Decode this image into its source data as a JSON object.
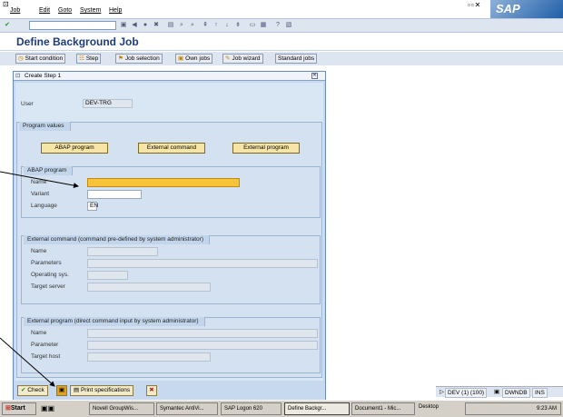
{
  "menubar": {
    "items": [
      "Job",
      "Edit",
      "Goto",
      "System",
      "Help"
    ],
    "logo": "SAP"
  },
  "page_title": "Define Background Job",
  "appbar": {
    "buttons": [
      "Start condition",
      "Step",
      "Job selection",
      "Own jobs",
      "Job wizard",
      "Standard jobs"
    ]
  },
  "dialog": {
    "title": "Create Step 1",
    "user_label": "User",
    "user_value": "DEV-TRG",
    "program_values_title": "Program values",
    "buttons": [
      "ABAP program",
      "External command",
      "External program"
    ],
    "abap_group": {
      "title": "ABAP program",
      "fields": [
        {
          "label": "Name",
          "value": ""
        },
        {
          "label": "Variant",
          "value": ""
        },
        {
          "label": "Language",
          "value": "EN"
        }
      ]
    },
    "ext_cmd_group": {
      "title": "External command (command pre-defined by system administrator)",
      "fields": [
        "Name",
        "Parameters",
        "Operating sys.",
        "Target server"
      ]
    },
    "ext_prog_group": {
      "title": "External program (direct command input by system administrator)",
      "fields": [
        "Name",
        "Parameter",
        "Target host"
      ]
    },
    "footer": {
      "check": "Check",
      "print": "Print specifications"
    }
  },
  "statusbar": {
    "system": "DEV (1) (100)",
    "server": "DWNDB",
    "mode": "INS"
  },
  "taskbar": {
    "start": "Start",
    "tasks": [
      "Novell GroupWis...",
      "Symantec AntiVi...",
      "SAP Logon 620",
      "Define Backgr...",
      "Document1 - Mic..."
    ],
    "desktop": "Desktop",
    "time": "9:23 AM"
  },
  "colors": {
    "required_field": "#f7c338",
    "dialog_bg": "#c7d9ee",
    "title": "#1d3c7a"
  }
}
